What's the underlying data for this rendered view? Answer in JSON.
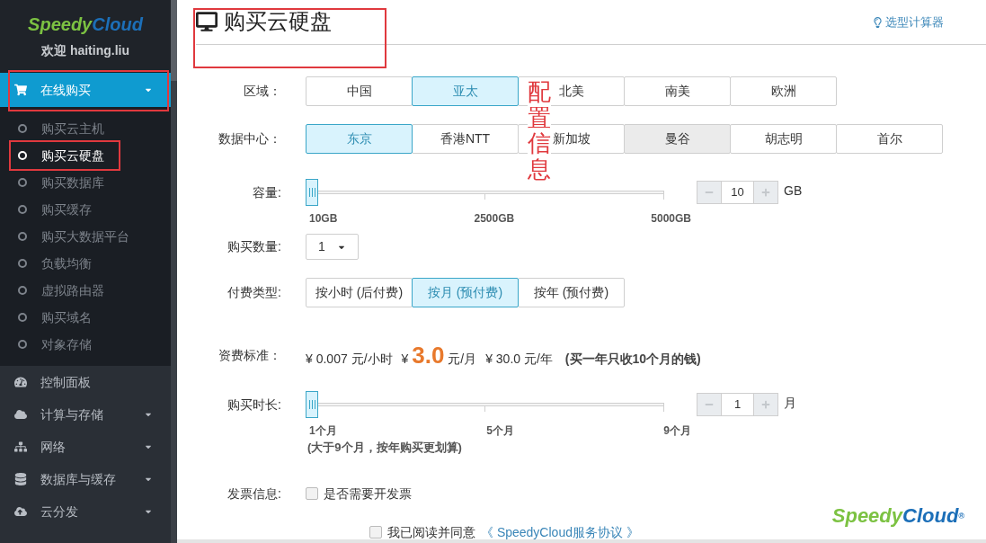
{
  "sidebar": {
    "logo": {
      "part_1": "Speedy",
      "part_2": "Cloud"
    },
    "welcome": "欢迎 haiting.liu",
    "menu": [
      {
        "label": "在线购买",
        "expanded": true,
        "has_submenu": true,
        "highlighted": true,
        "children": [
          {
            "label": "购买云主机",
            "selected": false,
            "highlighted": false
          },
          {
            "label": "购买云硬盘",
            "selected": true,
            "highlighted": true
          },
          {
            "label": "购买数据库",
            "selected": false,
            "highlighted": false
          },
          {
            "label": "购买缓存",
            "selected": false,
            "highlighted": false
          },
          {
            "label": "购买大数据平台",
            "selected": false,
            "highlighted": false
          },
          {
            "label": "负载均衡",
            "selected": false,
            "highlighted": false
          },
          {
            "label": "虚拟路由器",
            "selected": false,
            "highlighted": false
          },
          {
            "label": "购买域名",
            "selected": false,
            "highlighted": false
          },
          {
            "label": "对象存储",
            "selected": false,
            "highlighted": false
          }
        ]
      },
      {
        "label": "控制面板",
        "expanded": false,
        "has_submenu": false,
        "highlighted": false
      },
      {
        "label": "计算与存储",
        "expanded": false,
        "has_submenu": true,
        "highlighted": false
      },
      {
        "label": "网络",
        "expanded": false,
        "has_submenu": true,
        "highlighted": false
      },
      {
        "label": "数据库与缓存",
        "expanded": false,
        "has_submenu": true,
        "highlighted": false
      },
      {
        "label": "云分发",
        "expanded": false,
        "has_submenu": true,
        "highlighted": false
      }
    ]
  },
  "page": {
    "title": "购买云硬盘",
    "title_highlighted": true,
    "calculator_link": "选型计算器"
  },
  "annotation": "配置信息",
  "form": [
    {
      "kind": "options",
      "label": "区域：",
      "options": [
        {
          "label": "中国",
          "selected": false,
          "hovered": false
        },
        {
          "label": "亚太",
          "selected": true,
          "hovered": false
        },
        {
          "label": "北美",
          "selected": false,
          "hovered": false
        },
        {
          "label": "南美",
          "selected": false,
          "hovered": false
        },
        {
          "label": "欧洲",
          "selected": false,
          "hovered": false
        }
      ]
    },
    {
      "kind": "options",
      "label": "数据中心：",
      "options": [
        {
          "label": "东京",
          "selected": true,
          "hovered": false
        },
        {
          "label": "香港NTT",
          "selected": false,
          "hovered": false
        },
        {
          "label": "新加坡",
          "selected": false,
          "hovered": false
        },
        {
          "label": "曼谷",
          "selected": false,
          "hovered": true
        },
        {
          "label": "胡志明",
          "selected": false,
          "hovered": false
        },
        {
          "label": "首尔",
          "selected": false,
          "hovered": false
        }
      ]
    },
    {
      "kind": "slider",
      "label": "容量:",
      "level": 0,
      "ticks": [
        "10GB",
        "2500GB",
        "5000GB"
      ],
      "value": "10",
      "unit": "GB"
    },
    {
      "kind": "select",
      "label": "购买数量:",
      "value": "1"
    },
    {
      "kind": "options",
      "label": "付费类型:",
      "options": [
        {
          "label": "按小时 (后付费)",
          "selected": false,
          "hovered": false
        },
        {
          "label": "按月 (预付费)",
          "selected": true,
          "hovered": false
        },
        {
          "label": "按年 (预付费)",
          "selected": false,
          "hovered": false
        }
      ]
    },
    {
      "kind": "price",
      "label": "资费标准：",
      "prices": [
        {
          "currency": "¥",
          "amount": "0.007",
          "unit": "元/小时",
          "emphasized": false
        },
        {
          "currency": "¥",
          "amount": "3.0",
          "unit": "元/月",
          "emphasized": true
        },
        {
          "currency": "¥",
          "amount": "30.0",
          "unit": "元/年",
          "emphasized": false
        }
      ],
      "note": "(买一年只收10个月的钱)"
    },
    {
      "kind": "slider",
      "label": "购买时长:",
      "level": 0,
      "ticks": [
        "1个月",
        "5个月",
        "9个月"
      ],
      "value": "1",
      "unit": "月",
      "note": "(大于9个月，按年购买更划算)"
    },
    {
      "kind": "checkbox",
      "label": "发票信息:",
      "text": "是否需要开发票",
      "checked": false
    }
  ],
  "agreement": {
    "checked": false,
    "text": "我已阅读并同意",
    "link": "《 SpeedyCloud服务协议 》"
  },
  "footer_logo": {
    "part_1": "Speedy",
    "part_2": "Cloud",
    "mark": "®"
  }
}
